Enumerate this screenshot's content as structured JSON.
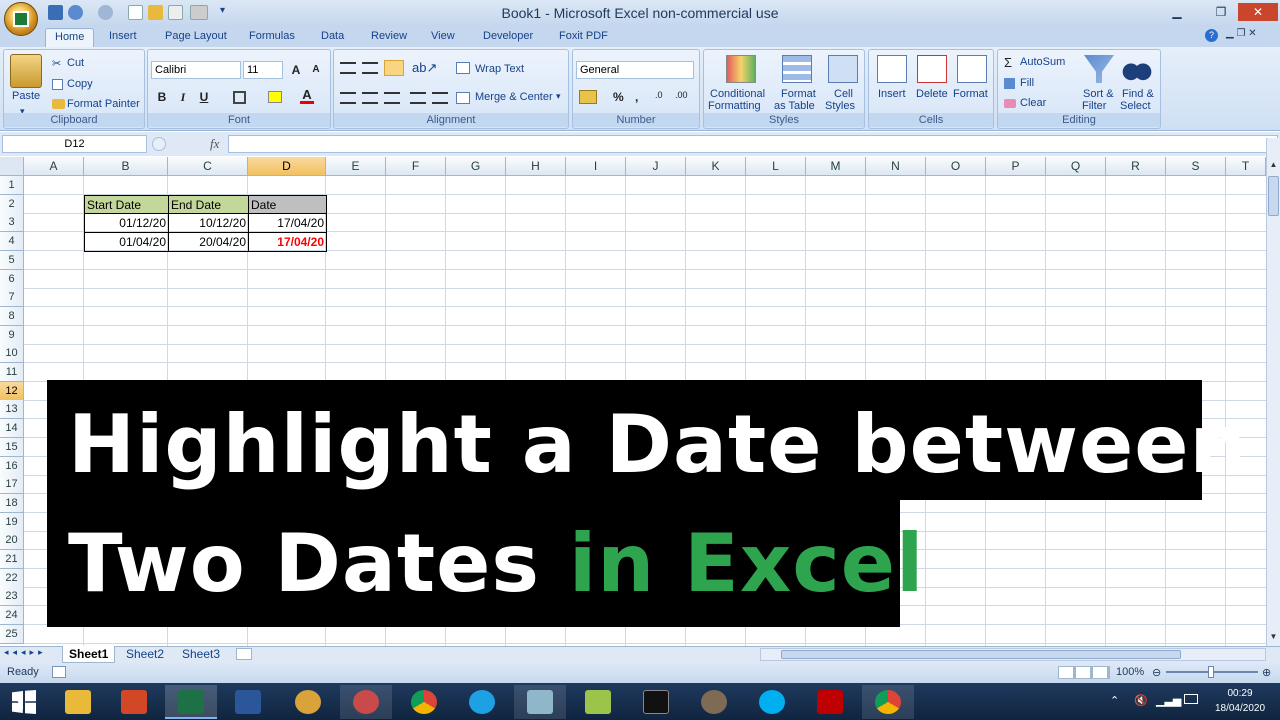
{
  "window": {
    "title": "Book1 - Microsoft Excel non-commercial use"
  },
  "tabs": [
    "Home",
    "Insert",
    "Page Layout",
    "Formulas",
    "Data",
    "Review",
    "View",
    "Developer",
    "Foxit PDF"
  ],
  "clipboard": {
    "paste": "Paste",
    "cut": "Cut",
    "copy": "Copy",
    "format_painter": "Format Painter",
    "label": "Clipboard"
  },
  "font": {
    "name": "Calibri",
    "size": "11",
    "label": "Font",
    "bold": "B",
    "italic": "I",
    "underline": "U"
  },
  "alignment": {
    "wrap": "Wrap Text",
    "merge": "Merge & Center",
    "label": "Alignment"
  },
  "number": {
    "format": "General",
    "label": "Number",
    "percent": "%"
  },
  "styles": {
    "conditional": [
      "Conditional",
      "Formatting"
    ],
    "format_table": [
      "Format",
      "as Table"
    ],
    "cell_styles": [
      "Cell",
      "Styles"
    ],
    "label": "Styles"
  },
  "cells": {
    "insert": "Insert",
    "delete": "Delete",
    "format": "Format",
    "label": "Cells"
  },
  "editing": {
    "autosum": "AutoSum",
    "fill": "Fill",
    "clear": "Clear",
    "sort": [
      "Sort &",
      "Filter"
    ],
    "find": [
      "Find &",
      "Select"
    ],
    "label": "Editing"
  },
  "formula_bar": {
    "name_box": "D12",
    "fx": "fx",
    "value": ""
  },
  "columns": [
    "A",
    "B",
    "C",
    "D",
    "E",
    "F",
    "G",
    "H",
    "I",
    "J",
    "K",
    "L",
    "M",
    "N",
    "O",
    "P",
    "Q",
    "R",
    "S",
    "T"
  ],
  "rows": [
    "1",
    "2",
    "3",
    "4",
    "5",
    "6",
    "7",
    "8",
    "9",
    "10",
    "11",
    "12",
    "13",
    "14",
    "15",
    "16",
    "17",
    "18",
    "19",
    "20",
    "21",
    "22",
    "23",
    "24",
    "25"
  ],
  "table": {
    "headers": [
      "Start Date",
      "End Date",
      "Date"
    ],
    "rows": [
      [
        "01/12/20",
        "10/12/20",
        "17/04/20"
      ],
      [
        "01/04/20",
        "20/04/20",
        "17/04/20"
      ]
    ],
    "highlight_color": "#ff0000"
  },
  "banner": {
    "line1": "Highlight a Date between",
    "line2a": "Two Dates ",
    "line2b": "in Excel",
    "accent": "#2ea44f"
  },
  "sheets": [
    "Sheet1",
    "Sheet2",
    "Sheet3"
  ],
  "status": {
    "ready": "Ready",
    "zoom": "100%"
  },
  "taskbar": {
    "time": "00:29",
    "date": "18/04/2020"
  }
}
